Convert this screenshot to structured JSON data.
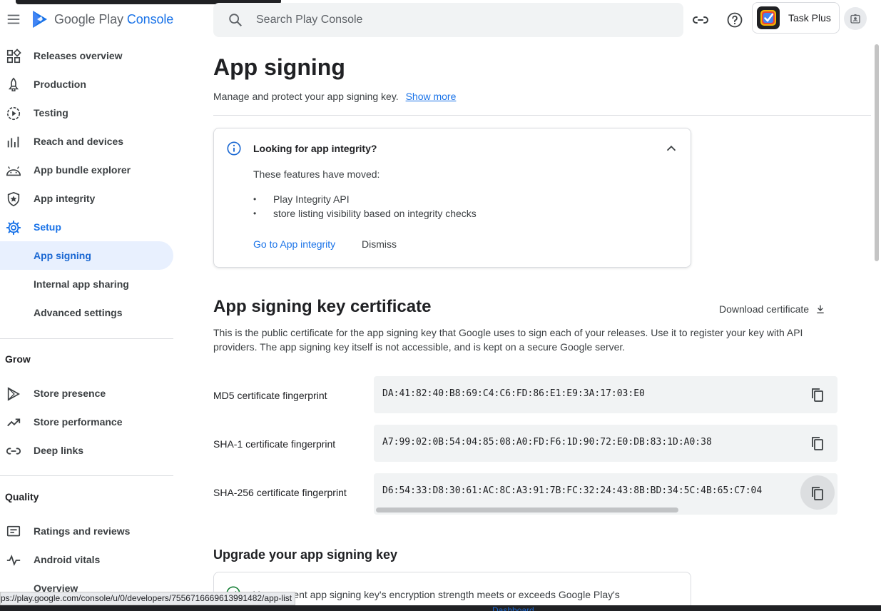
{
  "header": {
    "logo_prefix": "Google Play",
    "logo_suffix": "Console",
    "search_placeholder": "Search Play Console",
    "app_name": "Task Plus"
  },
  "sidebar": {
    "items": [
      {
        "label": "Releases overview",
        "icon": "dashboard-icon"
      },
      {
        "label": "Production",
        "icon": "rocket-icon"
      },
      {
        "label": "Testing",
        "icon": "play-circle-icon"
      },
      {
        "label": "Reach and devices",
        "icon": "bar-chart-icon"
      },
      {
        "label": "App bundle explorer",
        "icon": "android-icon"
      },
      {
        "label": "App integrity",
        "icon": "shield-icon"
      },
      {
        "label": "Setup",
        "icon": "gear-icon"
      }
    ],
    "setup_sub": [
      "App signing",
      "Internal app sharing",
      "Advanced settings"
    ],
    "grow_title": "Grow",
    "grow_items": [
      {
        "label": "Store presence",
        "icon": "play-triangle-icon"
      },
      {
        "label": "Store performance",
        "icon": "trending-icon"
      },
      {
        "label": "Deep links",
        "icon": "link-icon"
      }
    ],
    "quality_title": "Quality",
    "quality_items": [
      {
        "label": "Ratings and reviews",
        "icon": "reviews-icon"
      },
      {
        "label": "Android vitals",
        "icon": "vitals-icon"
      },
      {
        "label": "Overview",
        "icon": ""
      }
    ]
  },
  "main": {
    "title": "App signing",
    "subtitle": "Manage and protect your app signing key.",
    "show_more": "Show more",
    "integrity_card": {
      "title": "Looking for app integrity?",
      "text": "These features have moved:",
      "bullets": [
        "Play Integrity API",
        "store listing visibility based on integrity checks"
      ],
      "link": "Go to App integrity",
      "dismiss": "Dismiss"
    },
    "cert_section": {
      "title": "App signing key certificate",
      "download": "Download certificate",
      "description": "This is the public certificate for the app signing key that Google uses to sign each of your releases. Use it to register your key with API providers. The app signing key itself is not accessible, and is kept on a secure Google server.",
      "fingerprints": [
        {
          "label": "MD5 certificate fingerprint",
          "value": "DA:41:82:40:B8:69:C4:C6:FD:86:E1:E9:3A:17:03:E0"
        },
        {
          "label": "SHA-1 certificate fingerprint",
          "value": "A7:99:02:0B:54:04:85:08:A0:FD:F6:1D:90:72:E0:DB:83:1D:A0:38"
        },
        {
          "label": "SHA-256 certificate fingerprint",
          "value": "D6:54:33:D8:30:61:AC:8C:A3:91:7B:FC:32:24:43:8B:BD:34:5C:4B:65:C7:04"
        }
      ]
    },
    "upgrade": {
      "title": "Upgrade your app signing key",
      "text": "Your current app signing key's encryption strength meets or exceeds Google Play's minimum standard."
    }
  },
  "status_bar": {
    "url": "ps://play.google.com/console/u/0/developers/7556716669613991482/app-list",
    "partial_tab": "Dashboard"
  },
  "colors": {
    "accent": "#1a73e8",
    "selected_bg": "#e8f0fe",
    "field_bg": "#f1f3f4"
  }
}
